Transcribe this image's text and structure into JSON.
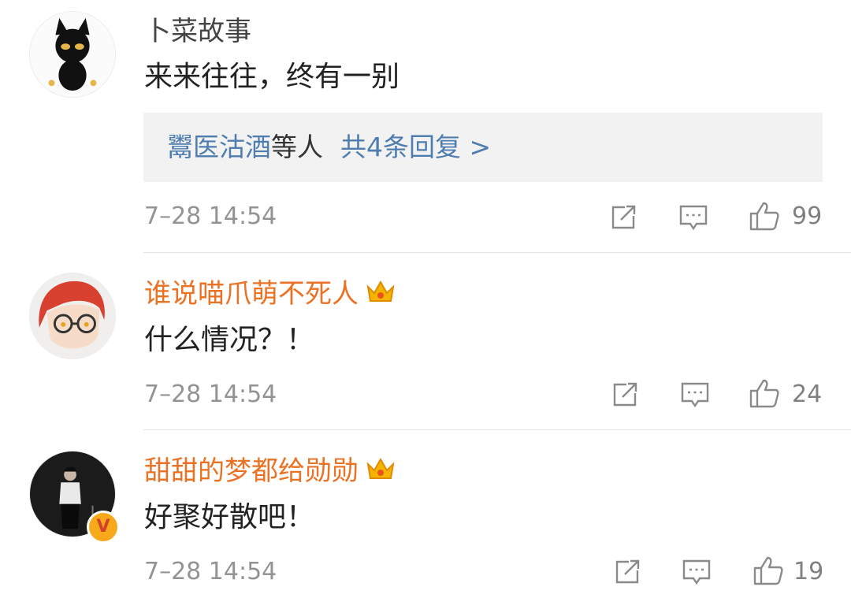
{
  "comments": [
    {
      "username": "卜菜故事",
      "text": "来来往往，终有一别",
      "replies": {
        "names": "鬻医沽酒",
        "others": "等人",
        "total": "共4条回复 >"
      },
      "time": "7–28 14:54",
      "likes": "99"
    },
    {
      "username": "谁说喵爪萌不死人",
      "text": "什么情况？！",
      "time": "7–28 14:54",
      "likes": "24"
    },
    {
      "username": "甜甜的梦都给勋勋",
      "text": "好聚好散吧！",
      "time": "7–28 14:54",
      "likes": "19",
      "verified_badge": "V"
    }
  ],
  "icons": {
    "share": "share-icon",
    "comment": "comment-icon",
    "like": "thumbs-up-icon",
    "crown": "vip-crown-icon"
  },
  "colors": {
    "vip_username": "#eb7224",
    "reply_link": "#507daf",
    "meta": "#939393",
    "crown": "#f4b400"
  }
}
